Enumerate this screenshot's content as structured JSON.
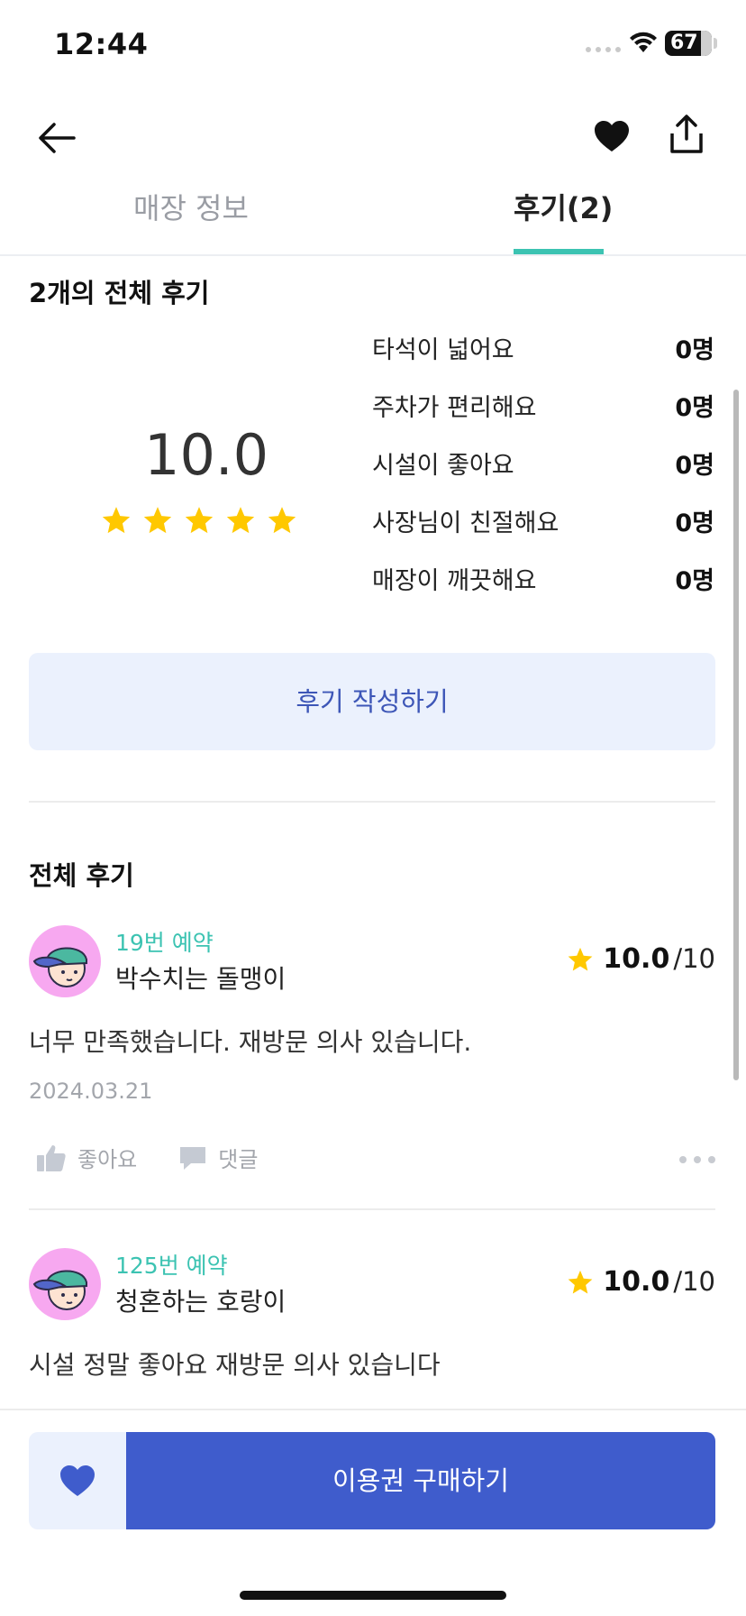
{
  "status_bar": {
    "time": "12:44",
    "battery": "67"
  },
  "header": {
    "back_icon": "arrow-left-icon",
    "favorite_icon": "heart-icon",
    "share_icon": "share-icon"
  },
  "tabs": [
    {
      "label": "매장 정보",
      "active": false
    },
    {
      "label": "후기(2)",
      "active": true
    }
  ],
  "summary": {
    "title": "2개의 전체 후기",
    "score": "10.0",
    "stars": 5,
    "tags": [
      {
        "label": "타석이 넓어요",
        "count": "0명"
      },
      {
        "label": "주차가 편리해요",
        "count": "0명"
      },
      {
        "label": "시설이 좋아요",
        "count": "0명"
      },
      {
        "label": "사장님이 친절해요",
        "count": "0명"
      },
      {
        "label": "매장이 깨끗해요",
        "count": "0명"
      }
    ],
    "write_button": "후기 작성하기"
  },
  "all_reviews": {
    "title": "전체 후기",
    "items": [
      {
        "booking": "19번 예약",
        "nickname": "박수치는 돌맹이",
        "rating": "10.0",
        "rating_max": "/10",
        "text": "너무 만족했습니다. 재방문 의사 있습니다.",
        "date": "2024.03.21",
        "like_label": "좋아요",
        "comment_label": "댓글"
      },
      {
        "booking": "125번 예약",
        "nickname": "청혼하는 호랑이",
        "rating": "10.0",
        "rating_max": "/10",
        "text": "시설 정말 좋아요 재방문 의사 있습니다"
      }
    ]
  },
  "bottom": {
    "buy_button": "이용권 구매하기"
  },
  "colors": {
    "accent_teal": "#3cc3b2",
    "primary_blue": "#3f5ccc",
    "star_yellow": "#ffc800",
    "light_blue_bg": "#ebf1fd"
  }
}
